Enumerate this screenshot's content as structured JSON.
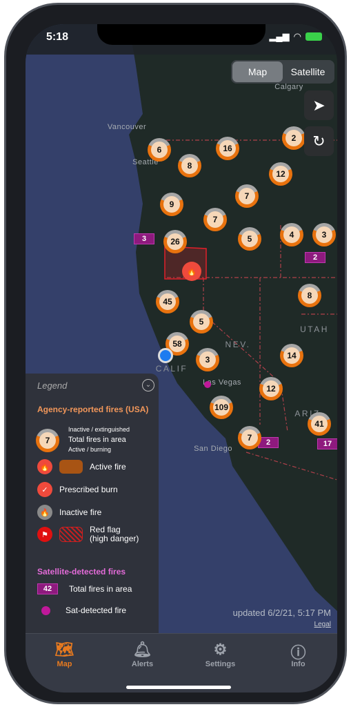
{
  "status": {
    "time": "5:18"
  },
  "map_toggle": {
    "options": [
      "Map",
      "Satellite"
    ],
    "selected": "Map"
  },
  "map": {
    "labels": [
      "Calgary",
      "Vancouver",
      "Seattle",
      "NEV.",
      "UTAH",
      "CALIF",
      "Las Vegas",
      "ARIZ.",
      "San Diego"
    ],
    "clusters": [
      2,
      6,
      16,
      8,
      12,
      7,
      9,
      7,
      5,
      4,
      3,
      26,
      45,
      8,
      5,
      58,
      3,
      14,
      12,
      109,
      41,
      7
    ],
    "sat_clusters": [
      3,
      2,
      2,
      17
    ]
  },
  "legend": {
    "title": "Legend",
    "agency_heading": "Agency-reported fires (USA)",
    "sample_count": "7",
    "inactive_label": "Inactive / extinguished",
    "total_label": "Total fires in area",
    "active_label": "Active / burning",
    "active_fire": "Active fire",
    "prescribed": "Prescribed burn",
    "inactive_fire": "Inactive fire",
    "red_flag": "Red flag",
    "red_flag_sub": "(high danger)",
    "sat_heading": "Satellite-detected fires",
    "sat_count": "42",
    "sat_total": "Total fires in area",
    "sat_fire": "Sat-detected fire"
  },
  "updated": "updated 6/2/21, 5:17 PM",
  "legal": "Legal",
  "tabs": [
    {
      "label": "Map",
      "active": true
    },
    {
      "label": "Alerts"
    },
    {
      "label": "Settings"
    },
    {
      "label": "Info"
    }
  ],
  "colors": {
    "accent": "#e87a1f",
    "satellite": "#8e1a7e",
    "red_flag": "#e0202a"
  }
}
